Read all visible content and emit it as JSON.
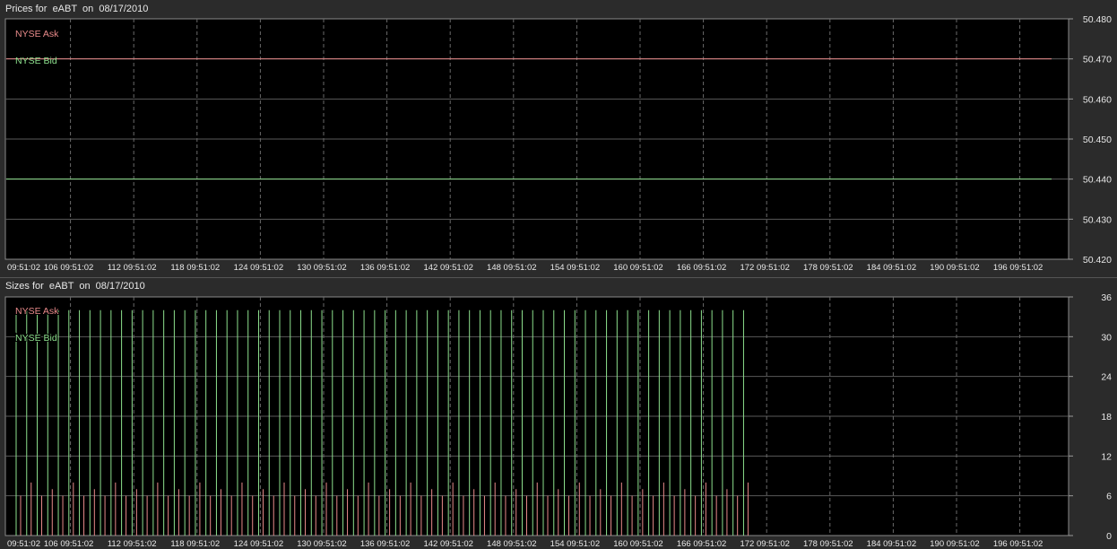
{
  "colors": {
    "background": "#2b2b2b",
    "plot_bg": "#000000",
    "grid": "#5a5a5a",
    "ask": "#e88a8a",
    "bid": "#8de08d",
    "text": "#e8e8e8"
  },
  "prices": {
    "title": "Prices for  eABT  on  08/17/2010"
  },
  "sizes": {
    "title": "Sizes for  eABT  on  08/17/2010"
  },
  "chart_data": [
    {
      "type": "line",
      "title": "Prices for  eABT  on  08/17/2010",
      "x_tick_labels": [
        "09:51:02",
        "106 09:51:02",
        "112 09:51:02",
        "118 09:51:02",
        "124 09:51:02",
        "130 09:51:02",
        "136 09:51:02",
        "142 09:51:02",
        "148 09:51:02",
        "154 09:51:02",
        "160 09:51:02",
        "166 09:51:02",
        "172 09:51:02",
        "178 09:51:02",
        "184 09:51:02",
        "190 09:51:02",
        "196 09:51:02"
      ],
      "y_ticks": [
        "50.480",
        "50.470",
        "50.460",
        "50.450",
        "50.440",
        "50.430",
        "50.420"
      ],
      "ylim": [
        50.42,
        50.48
      ],
      "grid": true,
      "legend_position": "top-left",
      "series": [
        {
          "name": "NYSE Ask",
          "color": "#e88a8a",
          "value": 50.47
        },
        {
          "name": "NYSE Bid",
          "color": "#8de08d",
          "value": 50.44
        }
      ]
    },
    {
      "type": "bar",
      "title": "Sizes for  eABT  on  08/17/2010",
      "x_tick_labels": [
        "09:51:02",
        "106 09:51:02",
        "112 09:51:02",
        "118 09:51:02",
        "124 09:51:02",
        "130 09:51:02",
        "136 09:51:02",
        "142 09:51:02",
        "148 09:51:02",
        "154 09:51:02",
        "160 09:51:02",
        "166 09:51:02",
        "172 09:51:02",
        "178 09:51:02",
        "184 09:51:02",
        "190 09:51:02",
        "196 09:51:02"
      ],
      "y_ticks": [
        "36",
        "30",
        "24",
        "18",
        "12",
        "6",
        "0"
      ],
      "ylim": [
        0,
        36
      ],
      "grid": true,
      "legend_position": "top-left",
      "bar_count": 70,
      "series": [
        {
          "name": "NYSE Ask",
          "color": "#e88a8a",
          "values": [
            6,
            8,
            6,
            7,
            6,
            8,
            6,
            7,
            6,
            8,
            6,
            7,
            6,
            8,
            6,
            7,
            6,
            8,
            6,
            7,
            6,
            8,
            6,
            7,
            6,
            8,
            6,
            7,
            6,
            8,
            6,
            7,
            6,
            8,
            6,
            7,
            6,
            8,
            6,
            7,
            6,
            8,
            6,
            7,
            6,
            8,
            6,
            7,
            6,
            8,
            6,
            7,
            6,
            8,
            6,
            7,
            6,
            8,
            6,
            7,
            6,
            8,
            6,
            7,
            6,
            8,
            6,
            7,
            6,
            8
          ]
        },
        {
          "name": "NYSE Bid",
          "color": "#8de08d",
          "values": [
            34,
            34,
            34,
            34,
            34,
            34,
            34,
            34,
            34,
            34,
            34,
            34,
            34,
            34,
            34,
            34,
            34,
            34,
            34,
            34,
            34,
            34,
            34,
            34,
            34,
            34,
            34,
            34,
            34,
            34,
            34,
            34,
            34,
            34,
            34,
            34,
            34,
            34,
            34,
            34,
            34,
            34,
            34,
            34,
            34,
            34,
            34,
            34,
            34,
            34,
            34,
            34,
            34,
            34,
            34,
            34,
            34,
            34,
            34,
            34,
            34,
            34,
            34,
            34,
            34,
            34,
            34,
            34,
            34,
            34
          ]
        }
      ]
    }
  ]
}
